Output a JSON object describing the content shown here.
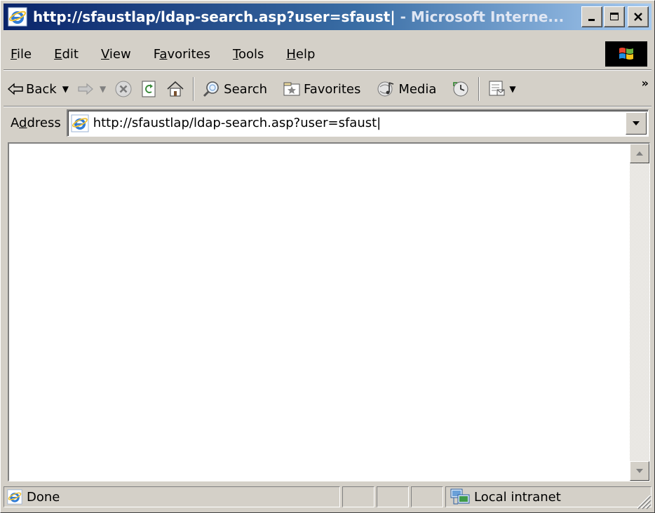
{
  "window": {
    "title_url": "http://sfaustlap/ldap-search.asp?user=sfaust|",
    "title_app": " - Microsoft Interne..."
  },
  "menu": [
    "File",
    "Edit",
    "View",
    "Favorites",
    "Tools",
    "Help"
  ],
  "menu_accel": [
    "F",
    "E",
    "V",
    "a",
    "T",
    "H"
  ],
  "toolbar": {
    "back": "Back",
    "search": "Search",
    "favorites": "Favorites",
    "media": "Media",
    "more": "»"
  },
  "address": {
    "label_pre": "A",
    "label_accel": "d",
    "label_post": "dress",
    "value": "http://sfaustlap/ldap-search.asp?user=sfaust|"
  },
  "status": {
    "text": "Done",
    "zone": "Local intranet"
  },
  "colors": {
    "title_gradient_start": "#0a246a",
    "title_gradient_end": "#a6caf0",
    "chrome": "#d4d0c8"
  },
  "icons": [
    "ie-icon",
    "minimize-icon",
    "maximize-icon",
    "close-icon",
    "windows-logo-icon",
    "back-arrow-icon",
    "forward-arrow-icon",
    "stop-icon",
    "refresh-icon",
    "home-icon",
    "search-icon",
    "favorites-icon",
    "media-icon",
    "history-icon",
    "mail-icon",
    "dropdown-arrow-icon",
    "scroll-up-icon",
    "scroll-down-icon",
    "page-icon",
    "local-intranet-icon",
    "resize-grip-icon"
  ]
}
